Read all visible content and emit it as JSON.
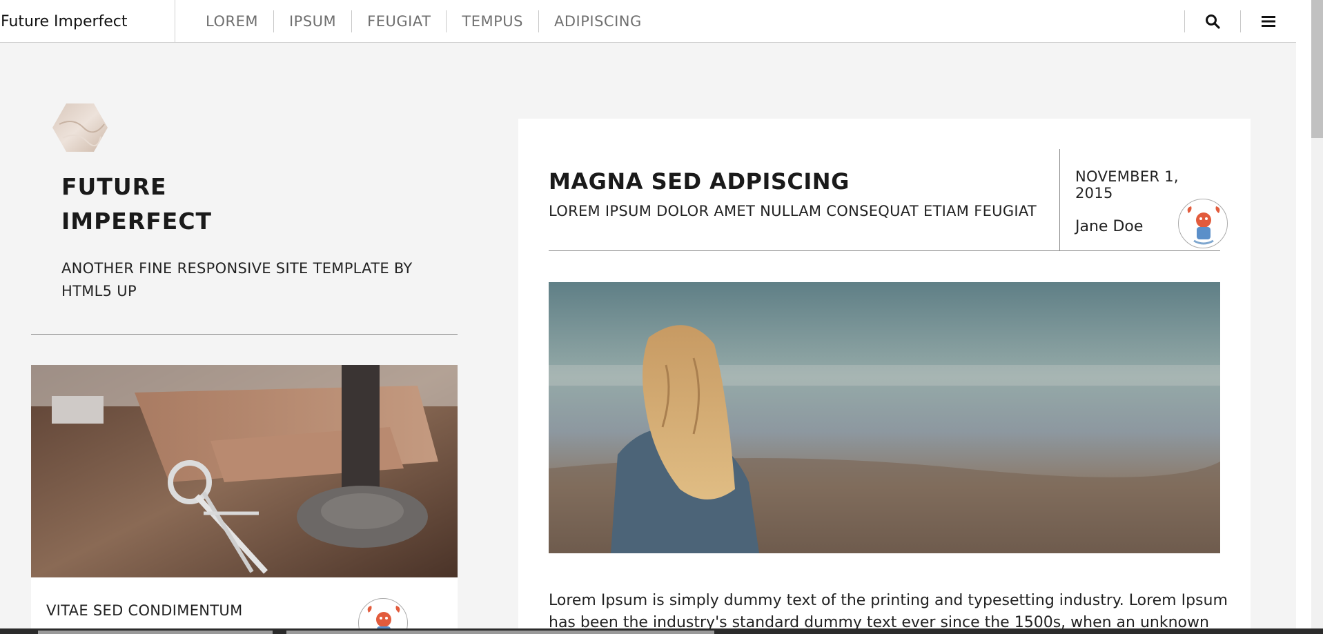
{
  "header": {
    "brand": "Future Imperfect",
    "nav": [
      "LOREM",
      "IPSUM",
      "FEUGIAT",
      "TEMPUS",
      "ADIPISCING"
    ]
  },
  "sidebar": {
    "title_line1": "FUTURE",
    "title_line2": "IMPERFECT",
    "subtitle": "ANOTHER FINE RESPONSIVE SITE TEMPLATE BY HTML5 UP",
    "mini_post_title": "VITAE SED CONDIMENTUM"
  },
  "post": {
    "title": "MAGNA SED ADPISCING",
    "subtitle": "LOREM IPSUM DOLOR AMET NULLAM CONSEQUAT ETIAM FEUGIAT",
    "date": "NOVEMBER 1, 2015",
    "author": "Jane Doe",
    "body": "Lorem Ipsum is simply dummy text of the printing and typesetting industry. Lorem Ipsum has been the industry's standard dummy text ever since the 1500s, when an unknown"
  },
  "icons": {
    "search": "search-icon",
    "menu": "menu-icon"
  }
}
